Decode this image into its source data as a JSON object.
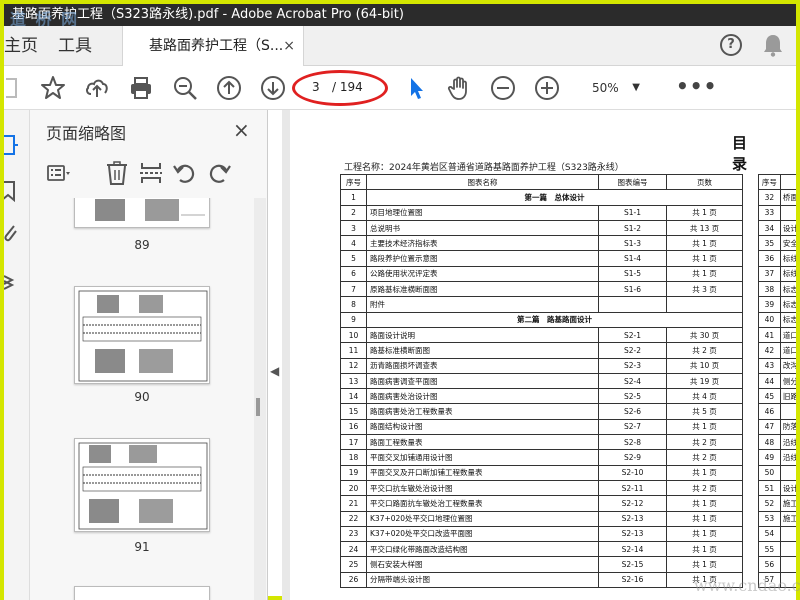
{
  "window": {
    "title": "基路面养护工程（S323路永线).pdf - Adobe Acrobat Pro (64-bit)"
  },
  "menubar": {
    "home": "主页",
    "tools": "工具",
    "tab_label": "基路面养护工程（S...",
    "tab_close": "×"
  },
  "toolbar": {
    "page_current": "3",
    "page_total": "/ 194",
    "zoom": "50%"
  },
  "sidebar": {
    "title": "页面缩略图",
    "close": "×",
    "thumbs": [
      {
        "label": "89"
      },
      {
        "label": "90"
      },
      {
        "label": "91"
      }
    ]
  },
  "document": {
    "toc_title": "目 录",
    "project_name": "工程名称：2024年黄岩区普通省道路基路面养护工程（S323路永线）",
    "headers": [
      "序号",
      "图表名称",
      "图表编号",
      "页数"
    ],
    "rows": [
      [
        "1",
        "第一篇　总体设计",
        "",
        "",
        true
      ],
      [
        "2",
        "项目地理位置图",
        "S1-1",
        "共 1 页",
        false
      ],
      [
        "3",
        "总说明书",
        "S1-2",
        "共 13 页",
        false
      ],
      [
        "4",
        "主要技术经济指标表",
        "S1-3",
        "共 1 页",
        false
      ],
      [
        "5",
        "路段养护位置示意图",
        "S1-4",
        "共 1 页",
        false
      ],
      [
        "6",
        "公路使用状况评定表",
        "S1-5",
        "共 1 页",
        false
      ],
      [
        "7",
        "原路基标准横断面图",
        "S1-6",
        "共 3 页",
        false
      ],
      [
        "8",
        "附件",
        "",
        "",
        false
      ],
      [
        "9",
        "第二篇　路基路面设计",
        "",
        "",
        true
      ],
      [
        "10",
        "路面设计说明",
        "S2-1",
        "共 30 页",
        false
      ],
      [
        "11",
        "路基标准横断面图",
        "S2-2",
        "共 2 页",
        false
      ],
      [
        "12",
        "沥青路面损坏调查表",
        "S2-3",
        "共 10 页",
        false
      ],
      [
        "13",
        "路面病害调查平面图",
        "S2-4",
        "共 19 页",
        false
      ],
      [
        "14",
        "路面病害处治设计图",
        "S2-5",
        "共 4 页",
        false
      ],
      [
        "15",
        "路面病害处治工程数量表",
        "S2-6",
        "共 5 页",
        false
      ],
      [
        "16",
        "路面结构设计图",
        "S2-7",
        "共 1 页",
        false
      ],
      [
        "17",
        "路面工程数量表",
        "S2-8",
        "共 2 页",
        false
      ],
      [
        "18",
        "平面交叉加铺通用设计图",
        "S2-9",
        "共 2 页",
        false
      ],
      [
        "19",
        "平面交叉及开口断加铺工程数量表",
        "S2-10",
        "共 1 页",
        false
      ],
      [
        "20",
        "平交口抗车辙处治设计图",
        "S2-11",
        "共 2 页",
        false
      ],
      [
        "21",
        "平交口路面抗车辙处治工程数量表",
        "S2-12",
        "共 1 页",
        false
      ],
      [
        "22",
        "K37+020处平交口地理位置图",
        "S2-13",
        "共 1 页",
        false
      ],
      [
        "23",
        "K37+020处平交口改造平面图",
        "S2-13",
        "共 1 页",
        false
      ],
      [
        "24",
        "平交口绿化带路面改造结构图",
        "S2-14",
        "共 1 页",
        false
      ],
      [
        "25",
        "侧石安装大样图",
        "S2-15",
        "共 1 页",
        false
      ],
      [
        "26",
        "分隔带端头设计图",
        "S2-16",
        "共 1 页",
        false
      ]
    ],
    "right_rows": [
      [
        "32",
        "桥面"
      ],
      [
        "33",
        ""
      ],
      [
        "34",
        "设计"
      ],
      [
        "35",
        "安全"
      ],
      [
        "36",
        "标线"
      ],
      [
        "37",
        "标线"
      ],
      [
        "38",
        "标志"
      ],
      [
        "39",
        "标志"
      ],
      [
        "40",
        "标志"
      ],
      [
        "41",
        "道口"
      ],
      [
        "42",
        "道口"
      ],
      [
        "43",
        "改沟"
      ],
      [
        "44",
        "侧分"
      ],
      [
        "45",
        "旧路"
      ],
      [
        "46",
        ""
      ],
      [
        "47",
        "防落"
      ],
      [
        "48",
        "沿线"
      ],
      [
        "49",
        "沿线"
      ],
      [
        "50",
        ""
      ],
      [
        "51",
        "设计"
      ],
      [
        "52",
        "施工"
      ],
      [
        "53",
        "施工"
      ],
      [
        "54",
        ""
      ],
      [
        "55",
        ""
      ],
      [
        "56",
        ""
      ],
      [
        "57",
        ""
      ]
    ]
  },
  "watermarks": {
    "top_left": "道 桥 网",
    "bottom_right": "www.cndao.com"
  },
  "colors": {
    "accent_blue": "#1473e6",
    "highlight_red": "#e02020",
    "frame_yellow": "#d4e600"
  }
}
